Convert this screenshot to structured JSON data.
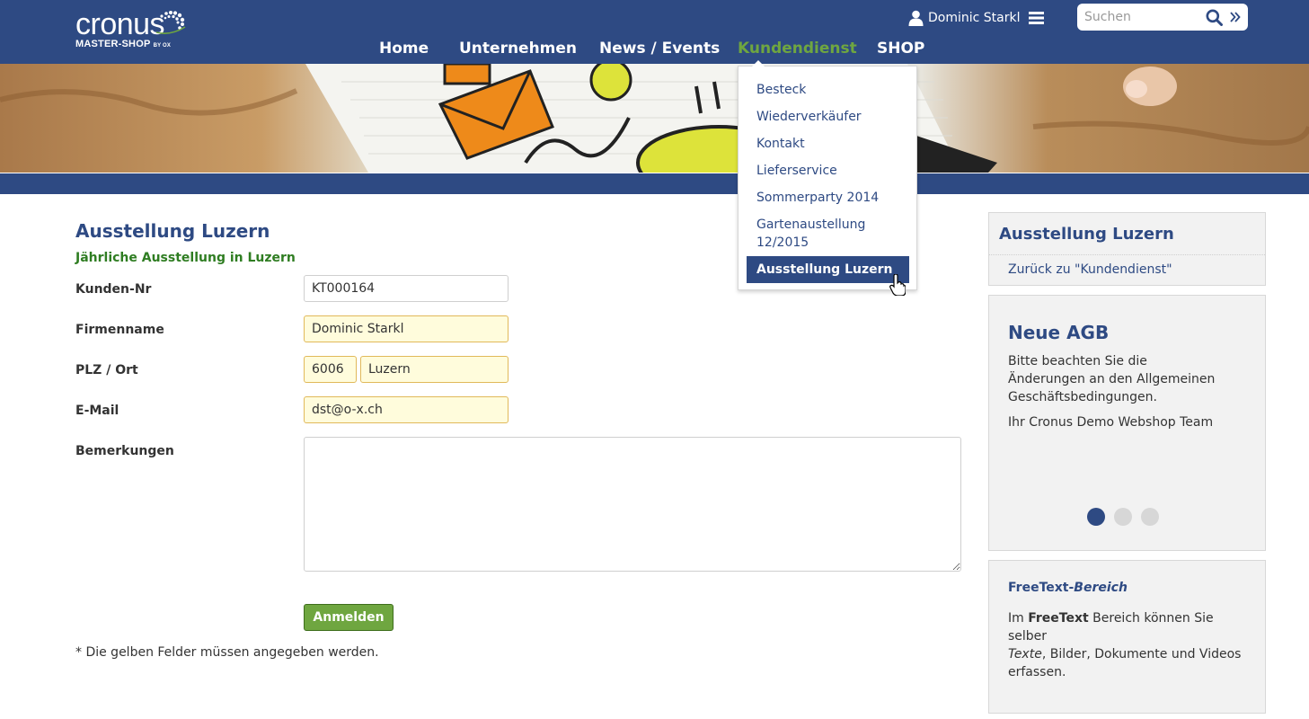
{
  "header": {
    "logo": {
      "word": "cronus",
      "sub": "MASTER-SHOP",
      "sub_small": "BY OX"
    },
    "user_name": "Dominic Starkl",
    "search_placeholder": "Suchen",
    "nav": [
      {
        "label": "Home",
        "active": false
      },
      {
        "label": "Unternehmen",
        "active": false
      },
      {
        "label": "News / Events",
        "active": false
      },
      {
        "label": "Kundendienst",
        "active": true
      },
      {
        "label": "SHOP",
        "active": false
      }
    ],
    "colors": {
      "bar": "#2e4a83",
      "active_nav": "#6fa640"
    }
  },
  "dropdown": {
    "items": [
      {
        "label": "Besteck"
      },
      {
        "label": "Wiederverkäufer"
      },
      {
        "label": "Kontakt"
      },
      {
        "label": "Lieferservice"
      },
      {
        "label": "Sommerparty 2014"
      },
      {
        "label": "Gartenaustellung 12/2015"
      },
      {
        "label": "Ausstellung Luzern",
        "selected": true
      }
    ]
  },
  "form": {
    "title": "Ausstellung Luzern",
    "subtitle": "Jährliche Ausstellung in Luzern",
    "fields": {
      "kunden_nr": {
        "label": "Kunden-Nr",
        "value": "KT000164"
      },
      "firmenname": {
        "label": "Firmenname",
        "value": "Dominic Starkl"
      },
      "plz_ort": {
        "label": "PLZ / Ort",
        "plz": "6006",
        "ort": "Luzern"
      },
      "email": {
        "label": "E-Mail",
        "value": "dst@o-x.ch"
      },
      "bemerkungen": {
        "label": "Bemerkungen",
        "value": ""
      }
    },
    "submit_label": "Anmelden",
    "footnote": "* Die gelben Felder müssen angegeben werden.",
    "colors": {
      "required_bg": "#fffcdc",
      "submit": "#6fa640"
    }
  },
  "sidebar": {
    "nav_box": {
      "title": "Ausstellung Luzern",
      "back_link": "Zurück zu \"Kundendienst\""
    },
    "agb_box": {
      "title": "Neue AGB",
      "text": "Bitte beachten Sie die Änderungen an den Allgemeinen Geschäftsbedingungen.",
      "signature": "Ihr Cronus Demo Webshop Team",
      "slides": 3,
      "active_slide": 1
    },
    "freetext_box": {
      "title_plain": "FreeText-",
      "title_italic": "Bereich",
      "text_before": "Im ",
      "text_bold": "FreeText",
      "text_mid": " Bereich können  Sie selber ",
      "text_italic": "Texte",
      "text_after": ", Bilder, Dokumente und Videos erfassen."
    }
  }
}
